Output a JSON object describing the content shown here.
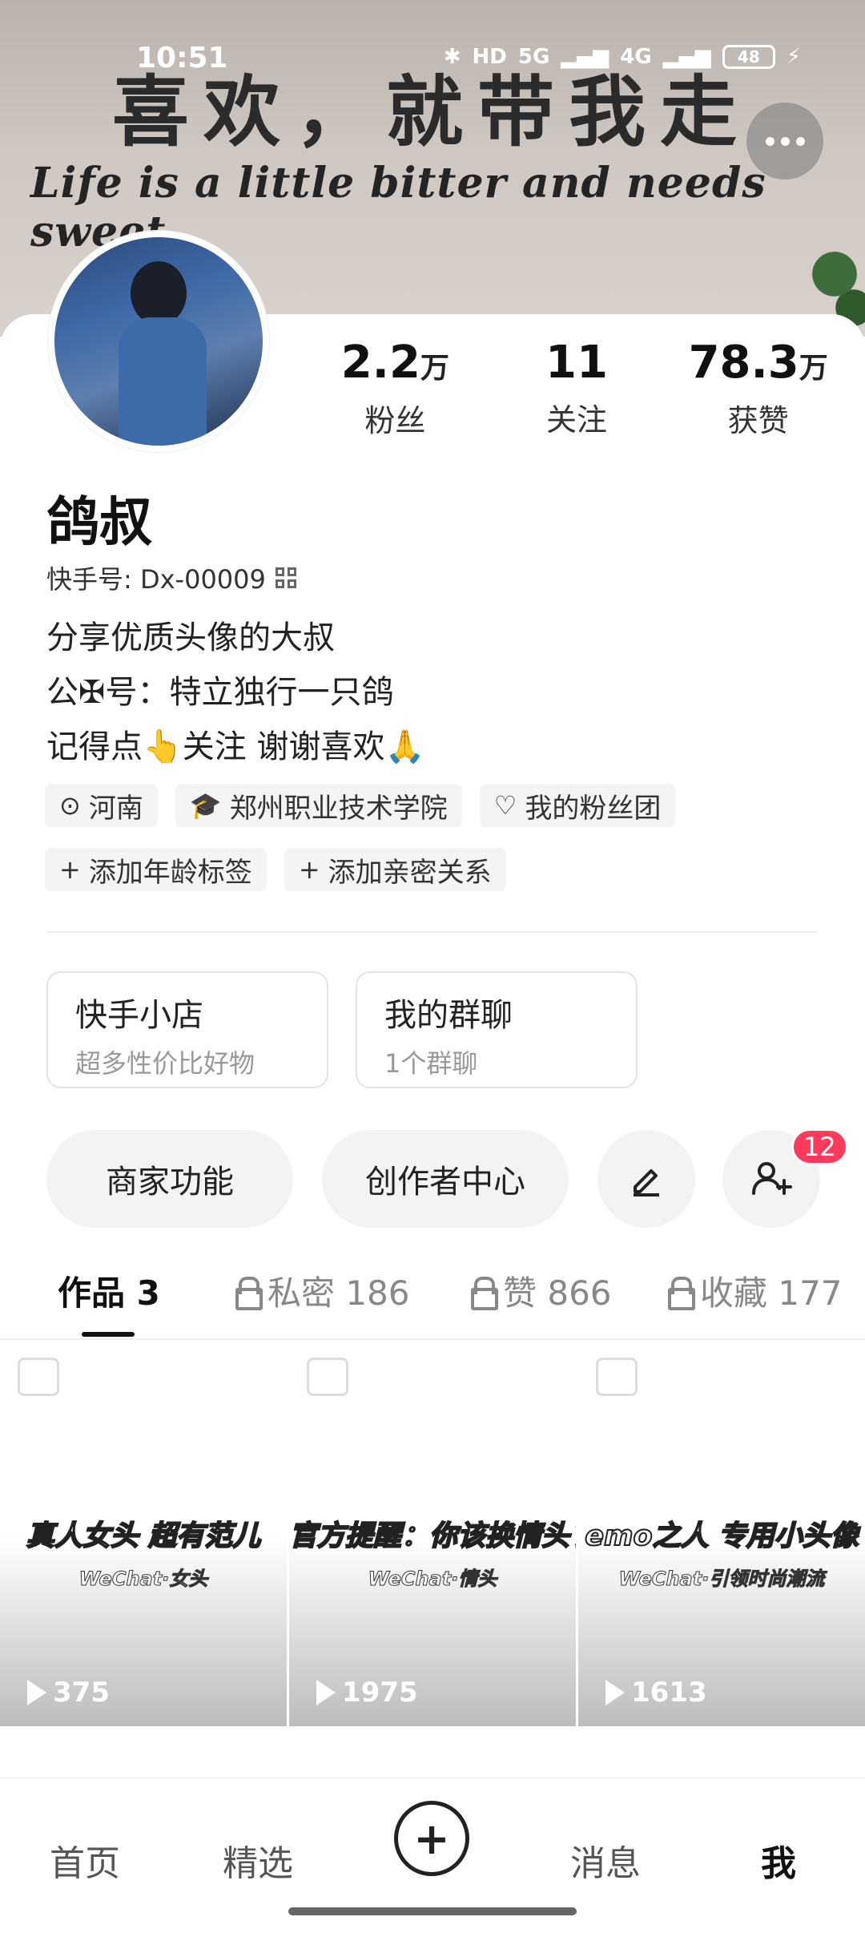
{
  "status_bar": {
    "time": "10:51",
    "indicators": [
      "HD",
      "5G",
      "4G"
    ],
    "battery": "48"
  },
  "banner": {
    "title_cn": "喜欢，就带我走",
    "title_en": "Life is a little bitter and needs sweet"
  },
  "profile": {
    "name": "鸽叔",
    "kuaishou_id": "快手号: Dx-00009",
    "bio": [
      "分享优质头像的大叔",
      "公✠号：特立独行一只鸽",
      "记得点👆关注 谢谢喜欢🙏"
    ]
  },
  "stats": [
    {
      "value": "2.2",
      "unit": "万",
      "label": "粉丝"
    },
    {
      "value": "11",
      "unit": "",
      "label": "关注"
    },
    {
      "value": "78.3",
      "unit": "万",
      "label": "获赞"
    }
  ],
  "tags": [
    {
      "icon": "⊙",
      "label": "河南"
    },
    {
      "icon": "🎓",
      "label": "郑州职业技术学院"
    },
    {
      "icon": "♡",
      "label": "我的粉丝团"
    },
    {
      "icon": "+",
      "label": "添加年龄标签"
    },
    {
      "icon": "+",
      "label": "添加亲密关系"
    }
  ],
  "services": [
    {
      "title": "快手小店",
      "subtitle": "超多性价比好物"
    },
    {
      "title": "我的群聊",
      "subtitle": "1个群聊"
    }
  ],
  "actions": {
    "merchant": "商家功能",
    "creator": "创作者中心",
    "friend_badge": "12"
  },
  "tabs": [
    {
      "label": "作品 3"
    },
    {
      "label": "私密 186"
    },
    {
      "label": "赞 866"
    },
    {
      "label": "收藏 177"
    }
  ],
  "posts": [
    {
      "caption": "真人女头 超有范儿",
      "sub": "WeChat·女头",
      "plays": "375"
    },
    {
      "caption": "官方提醒：你该换情头了",
      "sub": "WeChat·情头",
      "plays": "1975"
    },
    {
      "caption": "emo之人 专用小头像",
      "sub": "WeChat·引领时尚潮流",
      "plays": "1613"
    }
  ],
  "nav": {
    "home": "首页",
    "featured": "精选",
    "plus": "+",
    "messages": "消息",
    "me": "我"
  }
}
